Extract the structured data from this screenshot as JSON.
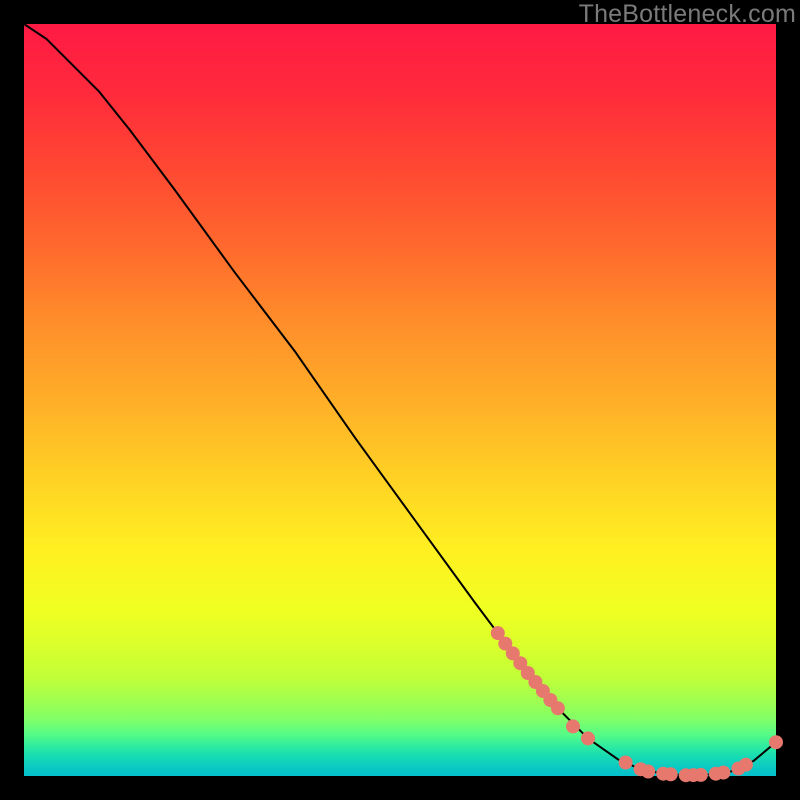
{
  "watermark": "TheBottleneck.com",
  "colors": {
    "dot": "#e6786e",
    "curve": "#000000"
  },
  "chart_data": {
    "type": "line",
    "title": "",
    "xlabel": "",
    "ylabel": "",
    "xlim": [
      0,
      100
    ],
    "ylim": [
      0,
      100
    ],
    "series": [
      {
        "name": "bottleneck-curve",
        "x": [
          0,
          3,
          6,
          10,
          14,
          20,
          28,
          36,
          44,
          52,
          60,
          66,
          71,
          75,
          79,
          82,
          85,
          88,
          91,
          94,
          97,
          100
        ],
        "y": [
          100,
          98,
          95,
          91,
          86,
          78,
          67,
          56.5,
          45,
          34,
          23,
          15,
          9,
          5,
          2.2,
          0.9,
          0.3,
          0.1,
          0.2,
          0.6,
          2.0,
          4.5
        ]
      }
    ],
    "points": [
      {
        "x": 63,
        "y": 19.0
      },
      {
        "x": 64,
        "y": 17.6
      },
      {
        "x": 65,
        "y": 16.3
      },
      {
        "x": 66,
        "y": 15.0
      },
      {
        "x": 67,
        "y": 13.7
      },
      {
        "x": 68,
        "y": 12.5
      },
      {
        "x": 69,
        "y": 11.3
      },
      {
        "x": 70,
        "y": 10.1
      },
      {
        "x": 71,
        "y": 9.0
      },
      {
        "x": 73,
        "y": 6.6
      },
      {
        "x": 75,
        "y": 5.0
      },
      {
        "x": 80,
        "y": 1.8
      },
      {
        "x": 82,
        "y": 0.9
      },
      {
        "x": 83,
        "y": 0.6
      },
      {
        "x": 85,
        "y": 0.3
      },
      {
        "x": 86,
        "y": 0.22
      },
      {
        "x": 88,
        "y": 0.1
      },
      {
        "x": 89,
        "y": 0.12
      },
      {
        "x": 90,
        "y": 0.15
      },
      {
        "x": 92,
        "y": 0.3
      },
      {
        "x": 93,
        "y": 0.45
      },
      {
        "x": 95,
        "y": 1.0
      },
      {
        "x": 96,
        "y": 1.5
      },
      {
        "x": 100,
        "y": 4.5
      }
    ]
  }
}
